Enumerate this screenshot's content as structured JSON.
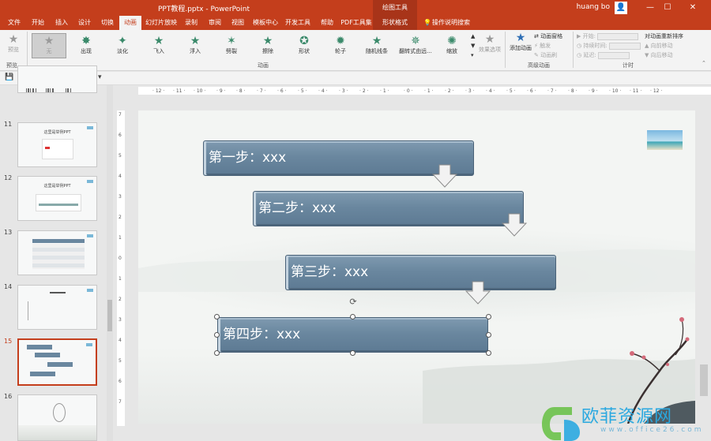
{
  "window": {
    "title": "PPT教程.pptx  -  PowerPoint",
    "context_tools": "绘图工具",
    "user": "huang bo",
    "minimize": "—",
    "restore": "☐",
    "close": "✕"
  },
  "tabs": [
    "文件",
    "开始",
    "插入",
    "设计",
    "切换",
    "动画",
    "幻灯片放映",
    "录制",
    "审阅",
    "视图",
    "模板中心",
    "开发工具",
    "帮助",
    "PDF工具集",
    "形状格式",
    "操作说明搜索"
  ],
  "ribbon": {
    "preview": {
      "label": "预览",
      "group": "预览"
    },
    "animations": [
      "无",
      "出现",
      "淡化",
      "飞入",
      "浮入",
      "劈裂",
      "擦除",
      "形状",
      "轮子",
      "随机线条",
      "翻转式由远...",
      "缩放"
    ],
    "effect_options": "效果选项",
    "group_animation": "动画",
    "add_animation": "添加动画",
    "animation_pane": "动画窗格",
    "trigger": "触发",
    "animation_painter": "动画刷",
    "group_advanced": "高级动画",
    "start_label": "开始:",
    "duration_label": "持续时间:",
    "delay_label": "延迟:",
    "group_timing": "计时",
    "reorder_title": "对动画重新排序",
    "move_earlier": "向前移动",
    "move_later": "向后移动"
  },
  "thumbnails": [
    {
      "num": "11",
      "title": "这里是举例PPT"
    },
    {
      "num": "12",
      "title": "这里是举例PPT"
    },
    {
      "num": "13",
      "title": ""
    },
    {
      "num": "14",
      "title": ""
    },
    {
      "num": "15",
      "title": ""
    },
    {
      "num": "16",
      "title": ""
    }
  ],
  "slide": {
    "steps": [
      "第一步：xxx",
      "第二步：xxx",
      "第三步：xxx",
      "第四步：xxx"
    ]
  },
  "watermark": {
    "text": "欧菲资源网",
    "url": "www.office26.com"
  },
  "colors": {
    "accent": "#c43e1c",
    "step_fill": "#6a879f"
  }
}
